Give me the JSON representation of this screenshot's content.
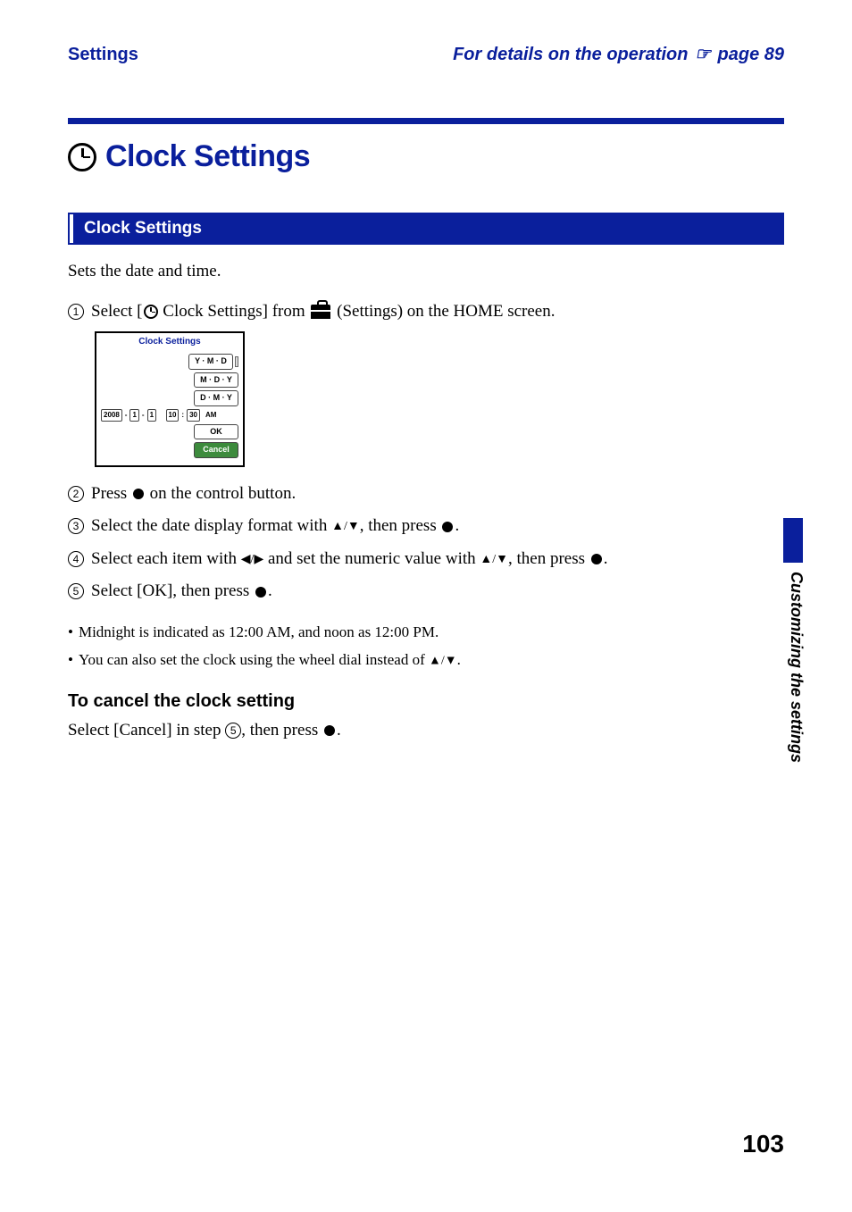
{
  "header": {
    "left": "Settings",
    "right_prefix": "For details on the operation",
    "right_ref": "page 89"
  },
  "title": "Clock Settings",
  "section_bar": "Clock Settings",
  "intro": "Sets the date and time.",
  "steps": {
    "s1_a": "Select [",
    "s1_b": " Clock Settings] from ",
    "s1_c": " (Settings) on the HOME screen.",
    "s2_a": "Press ",
    "s2_b": " on the control button.",
    "s3_a": "Select the date display format with ",
    "s3_b": ", then press ",
    "s3_c": ".",
    "s4_a": "Select each item with ",
    "s4_b": " and set the numeric value with ",
    "s4_c": ", then press ",
    "s4_d": ".",
    "s5_a": "Select [OK], then press ",
    "s5_b": "."
  },
  "arrows": {
    "updown": "▲/▼",
    "leftright": "◀/▶"
  },
  "screenshot": {
    "title": "Clock Settings",
    "fmt1": "Y · M · D",
    "fmt2": "M · D · Y",
    "fmt3": "D · M · Y",
    "year": "2008",
    "month": "1",
    "day": "1",
    "hour": "10",
    "min": "30",
    "ampm": "AM",
    "ok": "OK",
    "cancel": "Cancel"
  },
  "bullets": {
    "b1": "Midnight is indicated as 12:00 AM, and noon as 12:00 PM.",
    "b2_a": "You can also set the clock using the wheel dial instead of ",
    "b2_b": "."
  },
  "subheading": "To cancel the clock setting",
  "cancel_text_a": "Select [Cancel] in step ",
  "cancel_text_b": ", then press ",
  "cancel_text_c": ".",
  "cancel_step_ref": "5",
  "side_text": "Customizing the settings",
  "page_number": "103"
}
